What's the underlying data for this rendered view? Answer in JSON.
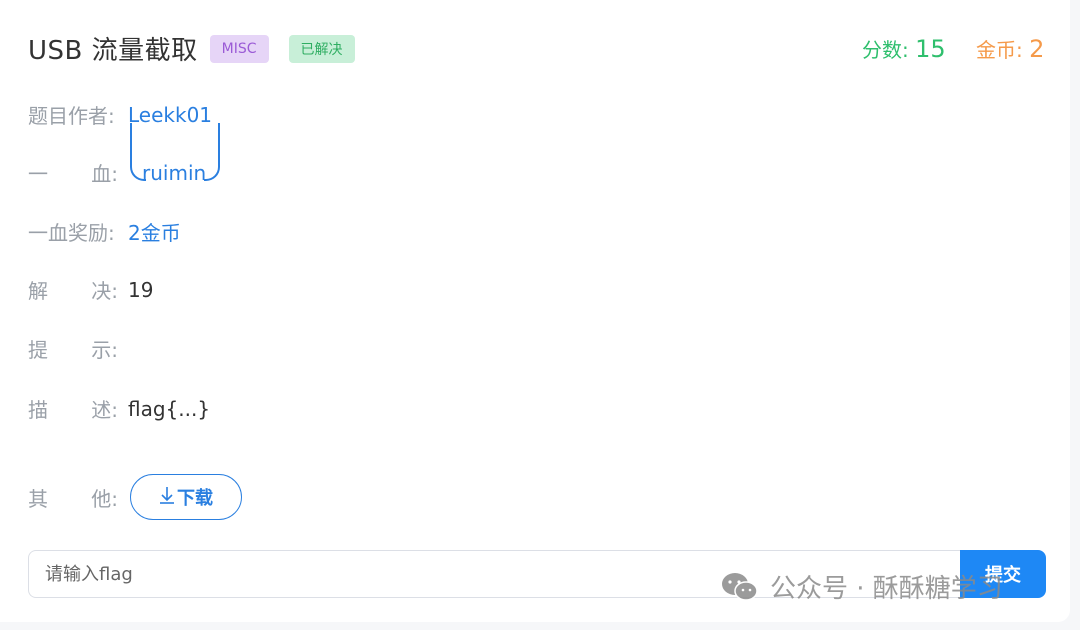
{
  "challenge": {
    "title": "USB 流量截取",
    "category_tag": "MISC",
    "status_tag": "已解决"
  },
  "score": {
    "points_label": "分数:",
    "points_value": "15",
    "coins_label": "金币:",
    "coins_value": "2"
  },
  "info": {
    "author_label": "题目作者:",
    "author_value": "Leekk01",
    "first_blood_label_a": "一",
    "first_blood_label_b": "血:",
    "first_blood_value": "ruimin",
    "first_blood_reward_label": "一血奖励:",
    "first_blood_reward_value": "2金币",
    "solves_label_a": "解",
    "solves_label_b": "决:",
    "solves_value": "19",
    "hint_label_a": "提",
    "hint_label_b": "示:",
    "hint_value": "",
    "desc_label_a": "描",
    "desc_label_b": "述:",
    "desc_value": "flag{...}",
    "other_label_a": "其",
    "other_label_b": "他:",
    "download_label": "下载"
  },
  "submit": {
    "placeholder": "请输入flag",
    "button_label": "提交"
  },
  "watermark": {
    "text": "公众号 · 酥酥糖学习"
  },
  "colors": {
    "accent_blue": "#1e88f5",
    "points_green": "#2fbf6d",
    "coins_orange": "#f59a4a",
    "misc_purple": "#9b5bd6",
    "solved_green": "#2fae62"
  }
}
